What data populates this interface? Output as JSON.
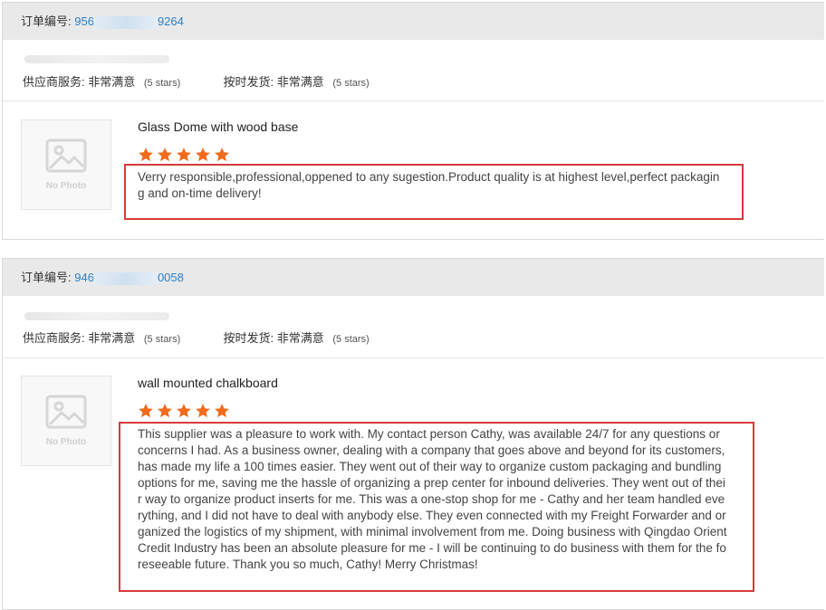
{
  "colors": {
    "accent_link": "#2a7fc6",
    "star": "#f26b1d",
    "highlight_box": "#d9393c",
    "header_bg": "#e9e9e9"
  },
  "reviews": [
    {
      "order_label": "订单编号:",
      "order_prefix": "956",
      "order_suffix": "9264",
      "service_label": "供应商服务:",
      "service_value": "非常满意",
      "service_stars": "(5 stars)",
      "shipping_label": "按时发货:",
      "shipping_value": "非常满意",
      "shipping_stars": "(5 stars)",
      "no_photo": "No Photo",
      "product_title": "Glass Dome with wood base",
      "rating": 5,
      "review_text": "Verry responsible,professional,oppened to any sugestion.Product quality is at highest level,perfect packaging and on-time delivery!"
    },
    {
      "order_label": "订单编号:",
      "order_prefix": "946",
      "order_suffix": "0058",
      "service_label": "供应商服务:",
      "service_value": "非常满意",
      "service_stars": "(5 stars)",
      "shipping_label": "按时发货:",
      "shipping_value": "非常满意",
      "shipping_stars": "(5 stars)",
      "no_photo": "No Photo",
      "product_title": "wall mounted chalkboard",
      "rating": 5,
      "review_text": "This supplier was a pleasure to work with. My contact person Cathy, was available 24/7 for any questions or concerns I had. As a business owner, dealing with a company that goes above and beyond for its customers, has made my life a 100 times easier. They went out of their way to organize custom packaging and bundling options for me, saving me the hassle of organizing a prep center for inbound deliveries. They went out of their way to organize product inserts for me. This was a one-stop shop for me - Cathy and her team handled everything, and I did not have to deal with anybody else. They even connected with my Freight Forwarder and organized the logistics of my shipment, with minimal involvement from me. Doing business with Qingdao Orient Credit Industry has been an absolute pleasure for me - I will be continuing to do business with them for the foreseeable future. Thank you so much, Cathy! Merry Christmas!"
    }
  ]
}
